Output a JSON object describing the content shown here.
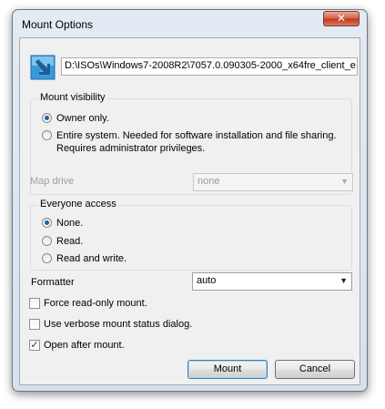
{
  "window": {
    "title": "Mount Options",
    "close_glyph": "✕"
  },
  "path": {
    "value": "D:\\ISOs\\Windows7-2008R2\\7057.0.090305-2000_x64fre_client_e",
    "icon": "mount-arrow-icon"
  },
  "visibility": {
    "group_label": "Mount visibility",
    "options": [
      {
        "label": "Owner only.",
        "checked": true
      },
      {
        "label": "Entire system. Needed for software installation and file sharing.",
        "label2": "Requires administrator privileges.",
        "checked": false
      }
    ],
    "map_drive_label": "Map drive",
    "map_drive_value": "none"
  },
  "everyone": {
    "group_label": "Everyone access",
    "options": [
      {
        "label": "None.",
        "checked": true
      },
      {
        "label": "Read.",
        "checked": false
      },
      {
        "label": "Read and write.",
        "checked": false
      }
    ]
  },
  "formatter": {
    "label": "Formatter",
    "value": "auto"
  },
  "checkboxes": [
    {
      "label": "Force read-only mount.",
      "checked": false
    },
    {
      "label": "Use verbose mount status dialog.",
      "checked": false
    },
    {
      "label": "Open after mount.",
      "checked": true
    }
  ],
  "buttons": {
    "mount": "Mount",
    "cancel": "Cancel"
  },
  "colors": {
    "accent": "#1f5fa8",
    "close": "#c43b1f"
  }
}
